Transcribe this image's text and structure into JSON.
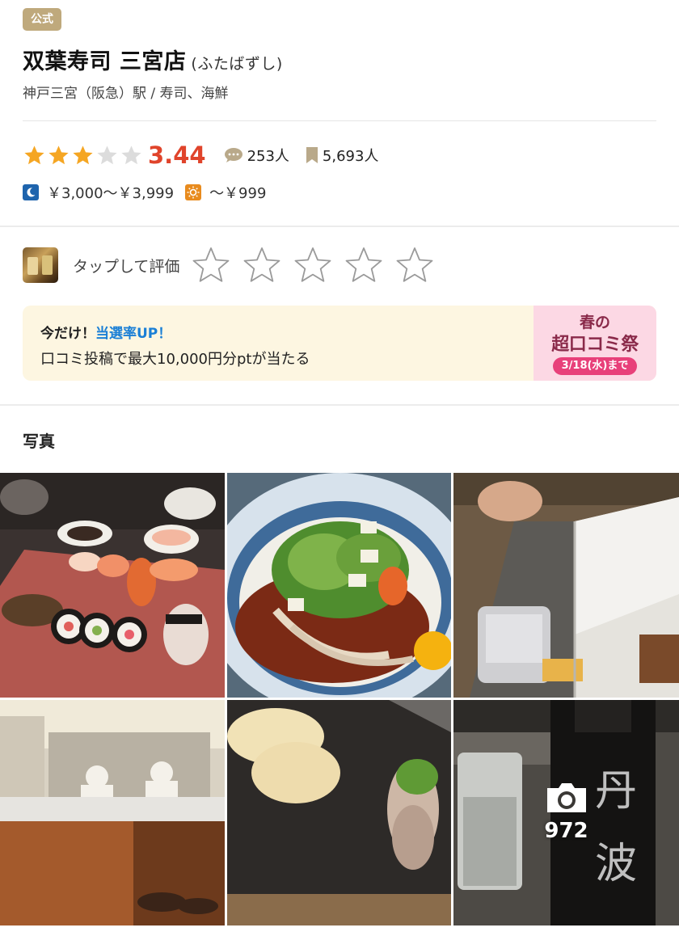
{
  "header": {
    "badge": "公式",
    "name": "双葉寿司 三宮店",
    "reading": "(ふたばずし)",
    "subinfo": "神戸三宮（阪急）駅 / 寿司、海鮮"
  },
  "rating": {
    "score": "3.44",
    "stars_filled": 3,
    "stars_total": 5,
    "reviews": "253人",
    "bookmarks": "5,693人"
  },
  "price": {
    "dinner": "￥3,000～￥3,999",
    "lunch": "～￥999"
  },
  "review_prompt": {
    "label": "タップして評価"
  },
  "banner": {
    "line1_prefix": "今だけ！",
    "line1_highlight": "当選率UP！",
    "line2": "口コミ投稿で最大10,000円分ptが当たる",
    "promo_line1": "春の",
    "promo_line2": "超口コミ祭",
    "promo_date": "3/18(水)まで"
  },
  "photos": {
    "heading": "写真",
    "count": "972"
  },
  "colors": {
    "badge": "#bfa97c",
    "score": "#e0442b",
    "star": "#f5a623",
    "highlight": "#1a7fd6",
    "promo_bg": "#fcd8e4"
  }
}
